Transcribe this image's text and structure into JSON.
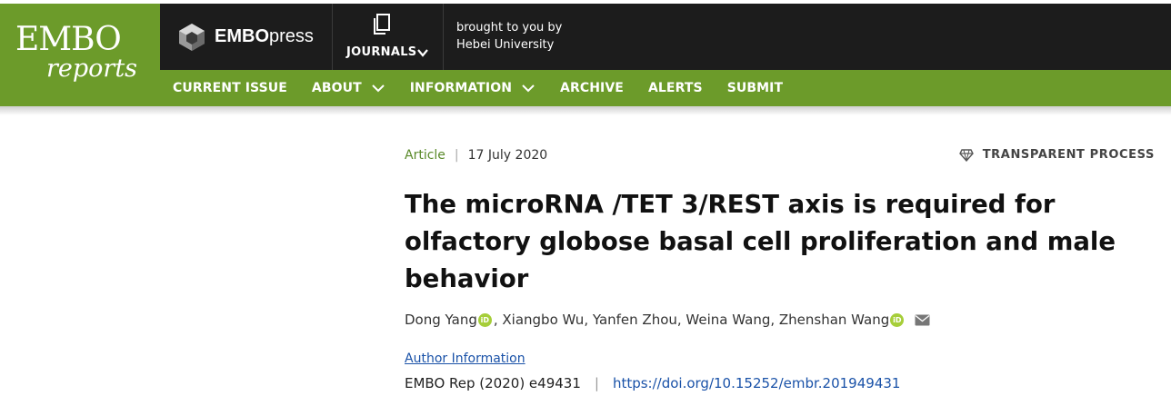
{
  "logo": {
    "line1": "EMBO",
    "line2": "reports"
  },
  "topbar": {
    "press_bold": "EMBO",
    "press_light": "press",
    "journals_label": "JOURNALS",
    "brought_line1": "brought to you by",
    "brought_line2": "Hebei University"
  },
  "nav": {
    "items": [
      {
        "label": "CURRENT ISSUE"
      },
      {
        "label": "ABOUT"
      },
      {
        "label": "INFORMATION"
      },
      {
        "label": "ARCHIVE"
      },
      {
        "label": "ALERTS"
      },
      {
        "label": "SUBMIT"
      }
    ]
  },
  "article": {
    "type": "Article",
    "separator": "|",
    "date": "17 July 2020",
    "badge": "TRANSPARENT PROCESS",
    "title": "The microRNA /TET 3/REST axis is required for olfactory globose basal cell proliferation and male behavior",
    "authors": {
      "a1": "Dong Yang",
      "rest": ", Xiangbo Wu, Yanfen Zhou, Weina Wang, Zhenshan Wang",
      "orcid_text": "iD"
    },
    "author_info": "Author Information",
    "citation": "EMBO Rep (2020) e49431",
    "cite_sep": "|",
    "doi": "https://doi.org/10.15252/embr.201949431"
  },
  "colors": {
    "brand_green": "#6c9b2a",
    "dark": "#1c1c1c",
    "link": "#1a52a8",
    "orcid": "#a6ce39"
  }
}
